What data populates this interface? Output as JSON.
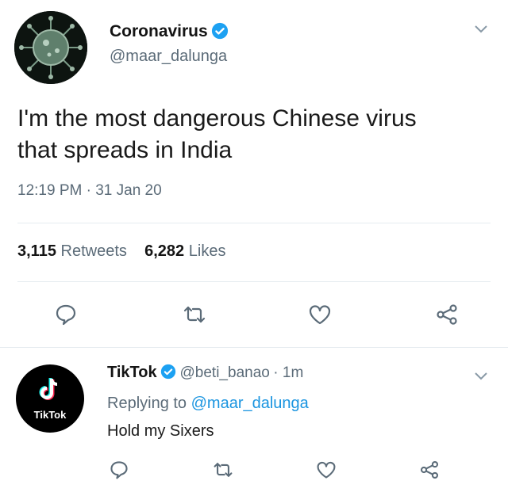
{
  "tweet": {
    "display_name": "Coronavirus",
    "handle": "@maar_dalunga",
    "text_line1": "I'm the most dangerous Chinese virus",
    "text_line2": "that spreads in India",
    "timestamp": "12:19 PM · 31 Jan 20",
    "retweets_count": "3,115",
    "retweets_label": "Retweets",
    "likes_count": "6,282",
    "likes_label": "Likes"
  },
  "reply": {
    "display_name": "TikTok",
    "handle": "@beti_banao",
    "time": "· 1m",
    "replying_label": "Replying to",
    "replying_handle": "@maar_dalunga",
    "text": "Hold my Sixers",
    "avatar_text": "TikTok"
  },
  "colors": {
    "verified": "#1da1f2",
    "link": "#1b95e0",
    "muted": "#5b6b78"
  },
  "icons": [
    "reply-icon",
    "retweet-icon",
    "like-icon",
    "share-icon",
    "verified-badge-icon",
    "chevron-down-icon"
  ]
}
